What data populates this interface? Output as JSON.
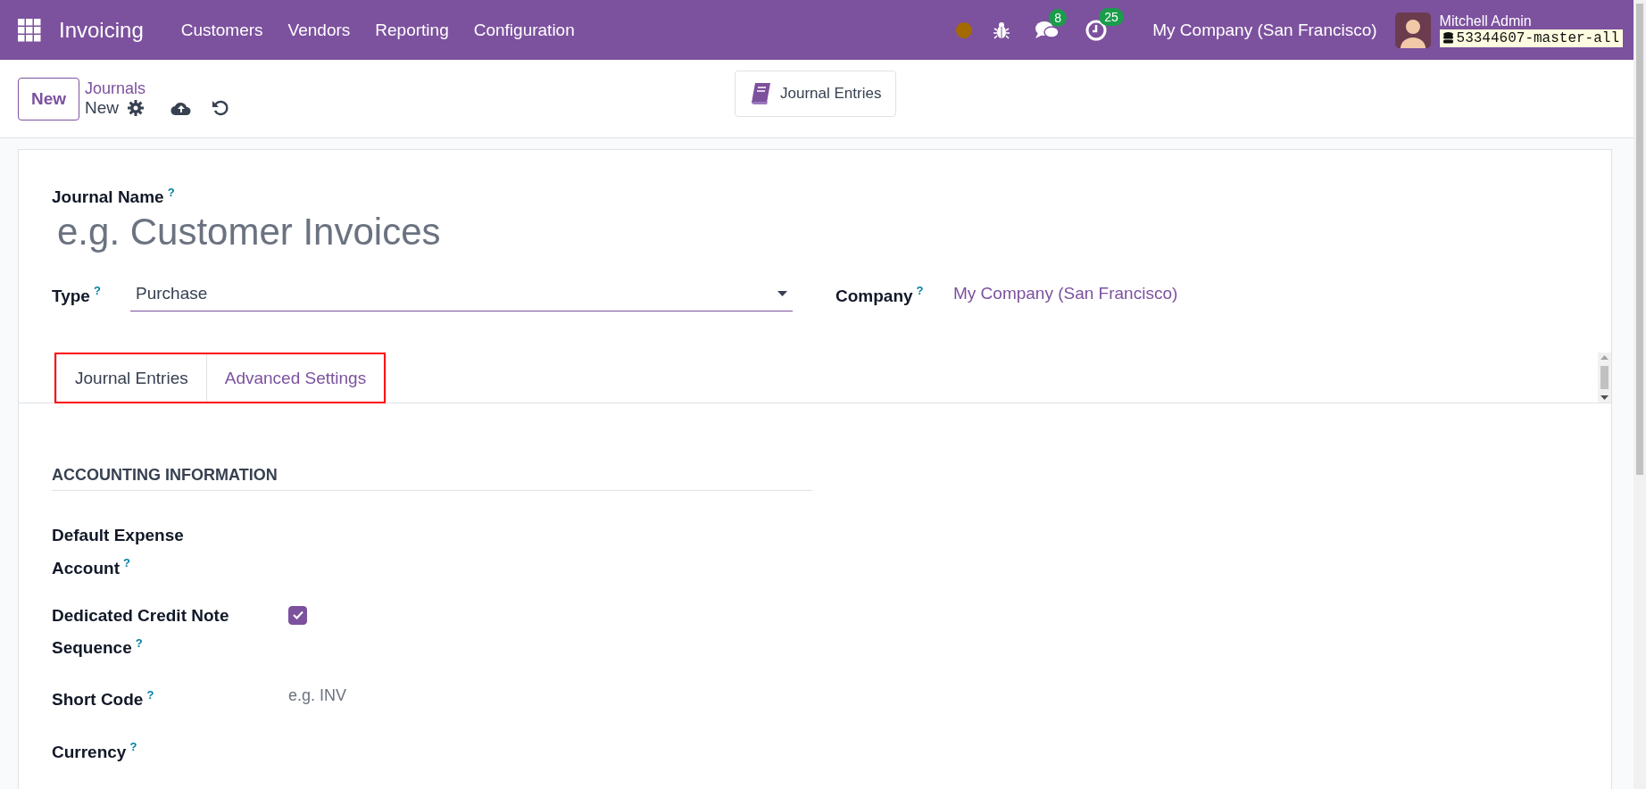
{
  "navbar": {
    "app_name": "Invoicing",
    "menus": [
      "Customers",
      "Vendors",
      "Reporting",
      "Configuration"
    ],
    "chat_badge": "8",
    "activity_badge": "25",
    "company": "My Company (San Francisco)",
    "user_name": "Mitchell Admin",
    "database": "53344607-master-all"
  },
  "control_panel": {
    "new_button": "New",
    "breadcrumb": "Journals",
    "record": "New",
    "smart_button": "Journal Entries"
  },
  "form": {
    "journal_name": {
      "label": "Journal Name",
      "help": "?",
      "placeholder": "e.g. Customer Invoices"
    },
    "type": {
      "label": "Type",
      "help": "?",
      "value": "Purchase"
    },
    "company": {
      "label": "Company",
      "help": "?",
      "value": "My Company (San Francisco)"
    },
    "tabs": [
      {
        "label": "Journal Entries",
        "selected": true
      },
      {
        "label": "Advanced Settings",
        "selected": false
      }
    ],
    "section_title": "ACCOUNTING INFORMATION",
    "fields": [
      {
        "kind": "empty",
        "label": "Default Expense Account",
        "help": "?"
      },
      {
        "kind": "checkbox",
        "label": "Dedicated Credit Note Sequence",
        "help": "?",
        "checked": true
      },
      {
        "kind": "input",
        "label": "Short Code",
        "help": "?",
        "placeholder": "e.g. INV"
      },
      {
        "kind": "empty",
        "label": "Currency",
        "help": "?"
      }
    ]
  }
}
